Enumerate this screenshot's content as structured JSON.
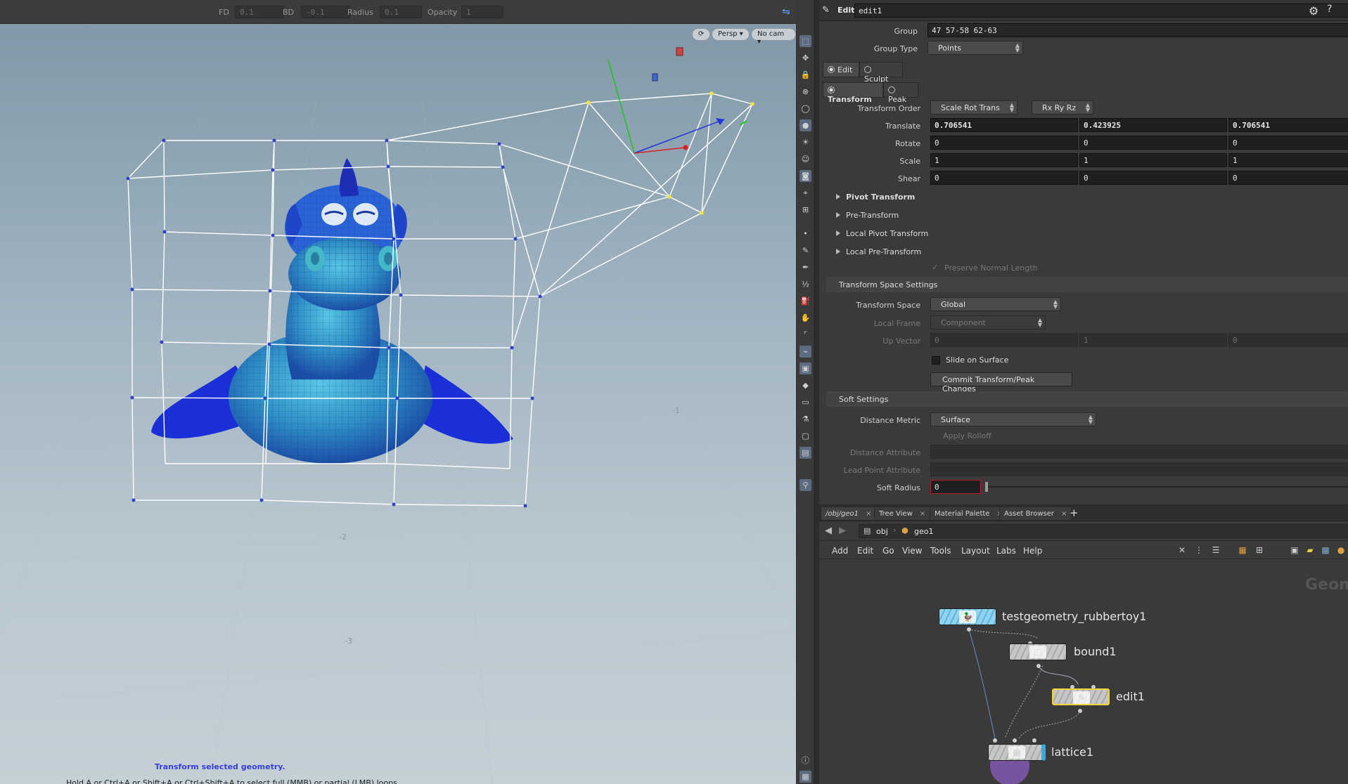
{
  "viewport": {
    "toolbar": {
      "fd_label": "FD",
      "fd_value": "0.1",
      "bd_label": "BD",
      "bd_value": "-0.1",
      "radius_label": "Radius",
      "radius_value": "0.1",
      "opacity_label": "Opacity",
      "opacity_value": "1"
    },
    "camera_menu": "Persp",
    "cam_menu": "No cam",
    "status_title": "Transform selected geometry.",
    "status_hint": "Hold A or Ctrl+A or Shift+A or Ctrl+Shift+A to select full (MMB) or partial (LMB) loops",
    "grid_numbers": [
      "-1",
      "-2",
      "-3"
    ]
  },
  "params": {
    "header": {
      "mode_label": "Edit",
      "node_name": "edit1"
    },
    "group_label": "Group",
    "group_value": "47 57-58 62-63",
    "group_type_label": "Group Type",
    "group_type_value": "Points",
    "mode_tabs": {
      "edit": "Edit",
      "sculpt": "Sculpt"
    },
    "op_tabs": {
      "transform": "Transform",
      "peak": "Peak"
    },
    "transform_order_label": "Transform Order",
    "transform_order_value": "Scale Rot Trans",
    "rotate_order_value": "Rx Ry Rz",
    "translate_label": "Translate",
    "translate": [
      "0.706541",
      "0.423925",
      "0.706541"
    ],
    "rotate_label": "Rotate",
    "rotate": [
      "0",
      "0",
      "0"
    ],
    "scale_label": "Scale",
    "scale": [
      "1",
      "1",
      "1"
    ],
    "shear_label": "Shear",
    "shear": [
      "0",
      "0",
      "0"
    ],
    "folders": [
      "Pivot Transform",
      "Pre-Transform",
      "Local Pivot Transform",
      "Local Pre-Transform"
    ],
    "preserve_normal_label": "Preserve Normal Length",
    "transform_space_settings": "Transform Space Settings",
    "transform_space_label": "Transform Space",
    "transform_space_value": "Global",
    "local_frame_label": "Local Frame",
    "local_frame_value": "Component",
    "up_vector_label": "Up Vector",
    "up_vector": [
      "0",
      "1",
      "0"
    ],
    "slide_on_surface_label": "Slide on Surface",
    "commit_button": "Commit Transform/Peak Changes",
    "soft_settings": "Soft Settings",
    "distance_metric_label": "Distance Metric",
    "distance_metric_value": "Surface",
    "apply_rolloff_label": "Apply Rolloff",
    "distance_attribute_label": "Distance Attribute",
    "lead_point_attribute_label": "Lead Point Attribute",
    "soft_radius_label": "Soft Radius",
    "soft_radius_value": "0"
  },
  "network": {
    "tabs": [
      "/obj/geo1",
      "Tree View",
      "Material Palette",
      "Asset Browser"
    ],
    "path": {
      "obj": "obj",
      "geo": "geo1"
    },
    "menu": [
      "Add",
      "Edit",
      "Go",
      "View",
      "Tools",
      "Layout",
      "Labs",
      "Help"
    ],
    "watermark": "Geom",
    "nodes": {
      "testgeometry": "testgeometry_rubbertoy1",
      "bound": "bound1",
      "edit": "edit1",
      "lattice": "lattice1"
    }
  },
  "colors": {
    "accent_selected_node": "#f2d23c",
    "status_title": "#3a3ed8",
    "lattice_cage": "#ffffff",
    "lattice_points": "#2f3fd0"
  }
}
